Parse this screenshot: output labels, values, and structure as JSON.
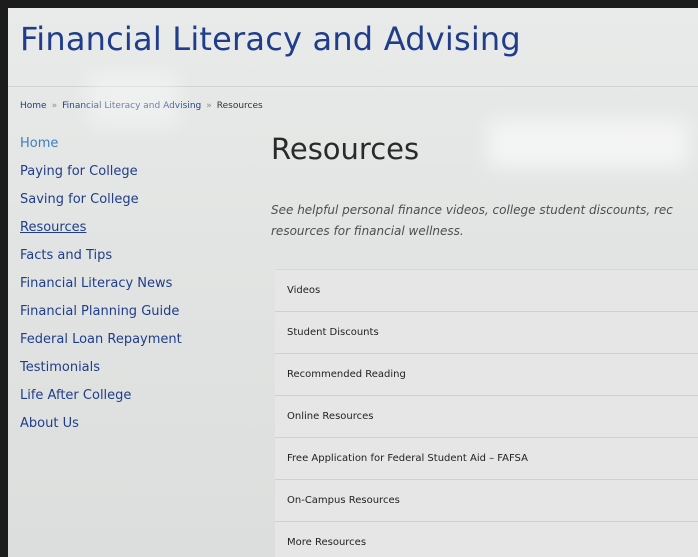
{
  "header": {
    "site_title": "Financial Literacy and Advising"
  },
  "breadcrumb": {
    "home": "Home",
    "section": "Financial Literacy and Advising",
    "current": "Resources",
    "separator": "»"
  },
  "sidebar": {
    "items": [
      {
        "label": "Home"
      },
      {
        "label": "Paying for College"
      },
      {
        "label": "Saving for College"
      },
      {
        "label": "Resources"
      },
      {
        "label": "Facts and Tips"
      },
      {
        "label": "Financial Literacy News"
      },
      {
        "label": "Financial Planning Guide"
      },
      {
        "label": "Federal Loan Repayment"
      },
      {
        "label": "Testimonials"
      },
      {
        "label": "Life After College"
      },
      {
        "label": "About Us"
      }
    ]
  },
  "main": {
    "heading": "Resources",
    "intro_line1": "See helpful personal finance videos, college student discounts, rec",
    "intro_line2": "resources for financial wellness.",
    "accordion": [
      {
        "label": "Videos"
      },
      {
        "label": "Student Discounts"
      },
      {
        "label": "Recommended Reading"
      },
      {
        "label": "Online Resources"
      },
      {
        "label": "Free Application for Federal Student Aid – FAFSA"
      },
      {
        "label": "On-Campus Resources"
      },
      {
        "label": "More Resources"
      }
    ]
  },
  "colors": {
    "brand_blue": "#1f3d8a",
    "link_blue": "#3f7cc4",
    "panel_bg": "#e5e6e5"
  }
}
